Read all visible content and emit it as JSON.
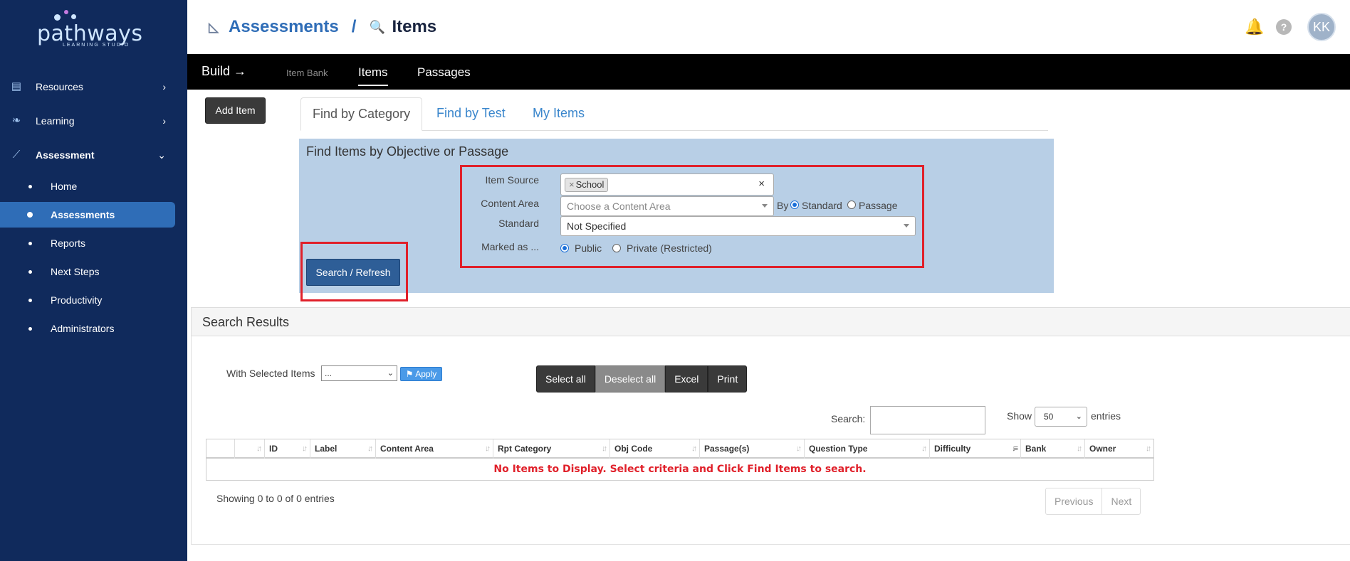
{
  "logo": {
    "word": "pathways",
    "sub": "LEARNING STUDIO"
  },
  "sidebar": {
    "top": [
      {
        "label": "Resources",
        "chevron": "›",
        "icon": "book-icon"
      },
      {
        "label": "Learning",
        "chevron": "›",
        "icon": "leaf-icon"
      },
      {
        "label": "Assessment",
        "chevron": "⌄",
        "icon": "chart-icon"
      }
    ],
    "sub": [
      {
        "label": "Home"
      },
      {
        "label": "Assessments"
      },
      {
        "label": "Reports"
      },
      {
        "label": "Next Steps"
      },
      {
        "label": "Productivity"
      },
      {
        "label": "Administrators"
      }
    ]
  },
  "header": {
    "crumb1": "Assessments",
    "separator": "/",
    "crumb2": "Items",
    "help": "?",
    "avatar": "KK"
  },
  "topnav": {
    "build": "Build →",
    "item_bank": "Item Bank",
    "items": "Items",
    "passages": "Passages"
  },
  "add_item": "Add Item",
  "tabs": [
    "Find by Category",
    "Find by Test",
    "My Items"
  ],
  "panel": {
    "title": "Find Items by Objective or Passage",
    "labels": {
      "item_source": "Item Source",
      "content_area": "Content Area",
      "standard": "Standard",
      "marked_as": "Marked as ..."
    },
    "item_source_tag": "School",
    "item_source_tag_remove": "×",
    "item_source_clear": "×",
    "content_area_placeholder": "Choose a Content Area",
    "by": "By",
    "by_standard": "Standard",
    "by_passage": "Passage",
    "standard_value": "Not Specified",
    "public": "Public",
    "private": "Private (Restricted)"
  },
  "search_button": "Search / Refresh",
  "results": {
    "title": "Search Results",
    "with_selected": "With Selected Items",
    "with_selected_value": "...",
    "apply": "Apply",
    "buttons": [
      "Select all",
      "Deselect all",
      "Excel",
      "Print"
    ],
    "search_label": "Search:",
    "show": "Show",
    "show_value": "50",
    "entries": "entries",
    "columns": [
      "",
      "ID",
      "Label",
      "Content Area",
      "Rpt Category",
      "Obj Code",
      "Passage(s)",
      "Question Type",
      "Difficulty",
      "Bank",
      "Owner"
    ],
    "empty_message": "No Items to Display. Select criteria and Click Find Items to search.",
    "showing": "Showing 0 to 0 of 0 entries",
    "previous": "Previous",
    "next": "Next"
  }
}
